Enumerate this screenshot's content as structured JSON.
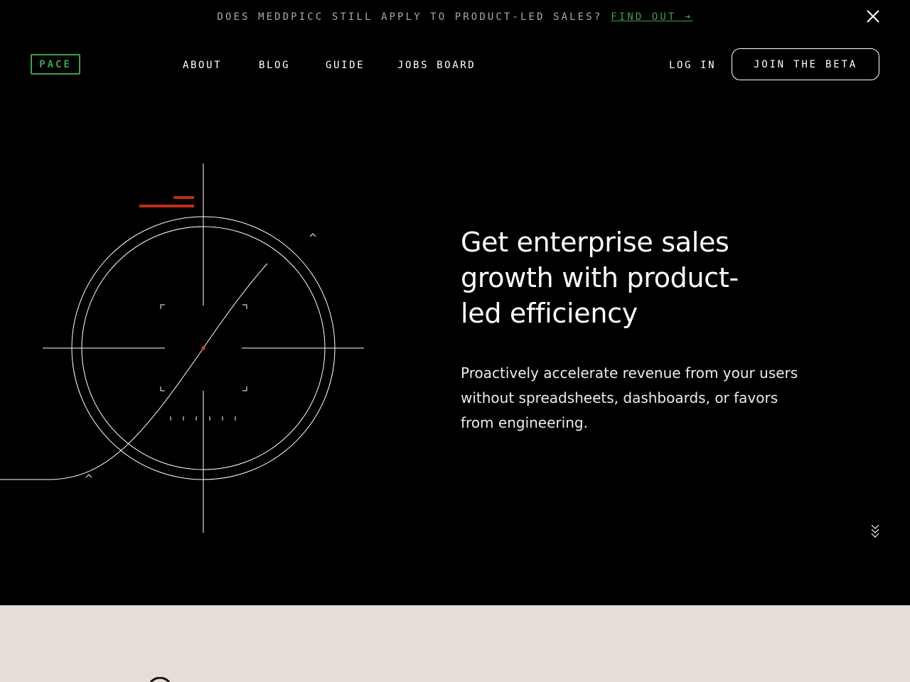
{
  "announcement": {
    "text": "DOES MEDDPICC STILL APPLY TO PRODUCT-LED SALES?",
    "link_label": "FIND OUT ➔",
    "close_icon": "close-icon"
  },
  "brand": {
    "logo_text": "PACE",
    "accent_color": "#3aa14e"
  },
  "nav": {
    "links": [
      {
        "label": "ABOUT"
      },
      {
        "label": "BLOG"
      },
      {
        "label": "GUIDE"
      },
      {
        "label": "JOBS BOARD"
      }
    ],
    "login_label": "LOG IN",
    "cta_label": "JOIN THE BETA"
  },
  "hero": {
    "headline": "Get enterprise sales growth with product-led efficiency",
    "subhead": "Proactively accelerate revenue from your users without spreadsheets, dashboards, or favors from engineering.",
    "illustration_icon": "targeting-reticle-icon",
    "marker_color": "#ff3b1f",
    "scroll_icon": "chevrons-down-icon"
  },
  "colors": {
    "background": "#000000",
    "section_bg": "#e5ddd7",
    "text": "#ffffff",
    "muted": "#a8a6b4"
  }
}
